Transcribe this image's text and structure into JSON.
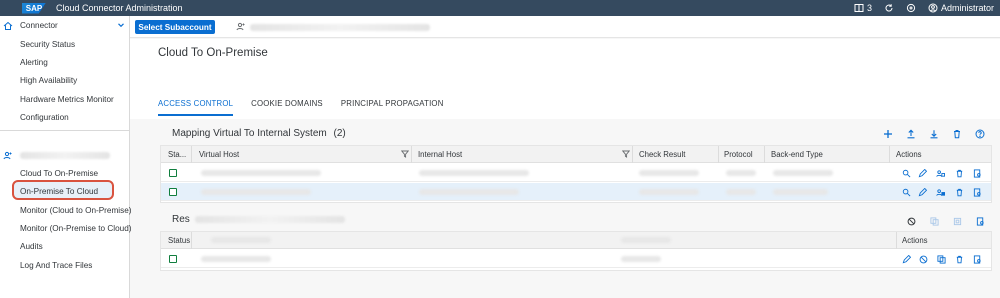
{
  "shell": {
    "logo_text": "SAP",
    "app_title": "Cloud Connector Administration",
    "notifications_count": "3",
    "user_label": "Administrator"
  },
  "nav": {
    "group_connector": "Connector",
    "items_connector": [
      "Security Status",
      "Alerting",
      "High Availability",
      "Hardware Metrics Monitor",
      "Configuration"
    ],
    "items_subaccount": [
      "Cloud To On-Premise",
      "On-Premise To Cloud",
      "Monitor (Cloud to On-Premise)",
      "Monitor (On-Premise to Cloud)",
      "Audits",
      "Log And Trace Files"
    ],
    "selected": "Cloud To On-Premise"
  },
  "subheader": {
    "select_button": "Select Subaccount"
  },
  "page": {
    "title": "Cloud To On-Premise",
    "tabs": [
      "ACCESS CONTROL",
      "COOKIE DOMAINS",
      "PRINCIPAL PROPAGATION"
    ],
    "active_tab": "ACCESS CONTROL"
  },
  "mapping_table": {
    "title": "Mapping Virtual To Internal System",
    "count": "(2)",
    "columns": [
      "Sta...",
      "Virtual Host",
      "Internal Host",
      "Check Result",
      "Protocol",
      "Back-end Type",
      "Actions"
    ]
  },
  "resources_table": {
    "title_prefix": "Res",
    "columns": [
      "Status",
      "Actions"
    ]
  },
  "colors": {
    "shell_bg": "#354a5f",
    "accent": "#0a6ed1",
    "highlight": "#d9533f",
    "status_green": "#107e3e"
  }
}
